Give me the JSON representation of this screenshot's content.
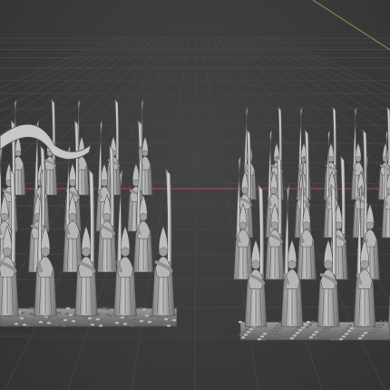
{
  "viewport": {
    "kind": "3d-viewport",
    "background_color": "#3a3a3a",
    "grid_color": "#4a4a4a",
    "x_axis_color": "#b04a55",
    "y_axis_color": "#7fa04a",
    "model_color": "#a9a9a9"
  },
  "units": [
    {
      "name": "left-regiment"
    },
    {
      "name": "right-regiment"
    }
  ]
}
